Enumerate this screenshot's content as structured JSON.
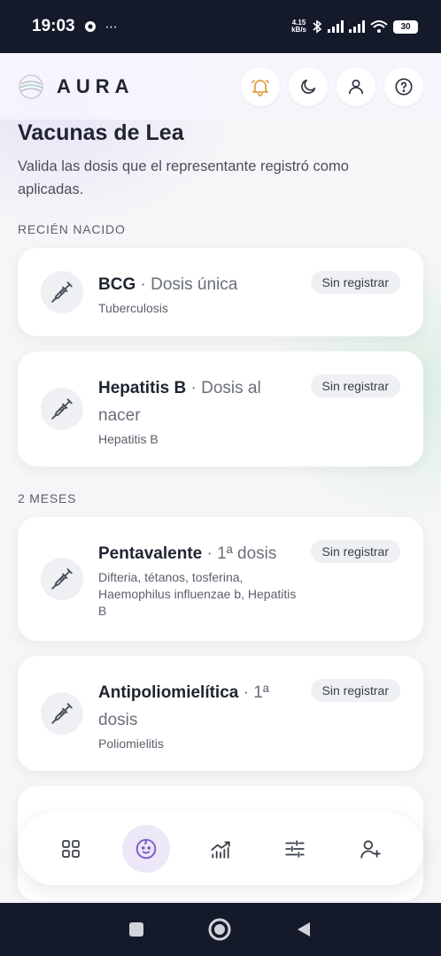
{
  "status_bar": {
    "time": "19:03",
    "extra": "⋯",
    "net_speed_value": "4.15",
    "net_speed_unit": "kB/s",
    "battery": "30"
  },
  "header": {
    "brand": "AURA",
    "icons": [
      "bell-icon",
      "moon-icon",
      "user-icon",
      "help-icon"
    ]
  },
  "page": {
    "title": "Vacunas de Lea",
    "subtitle": "Valida las dosis que el representante registró como aplicadas."
  },
  "sections": [
    {
      "label": "RECIÉN NACIDO",
      "vaccines": [
        {
          "name": "BCG",
          "separator": " · ",
          "dose": "Dosis única",
          "disease": "Tuberculosis",
          "status": "Sin registrar"
        },
        {
          "name": "Hepatitis B",
          "separator": " · ",
          "dose": "Dosis al nacer",
          "disease": "Hepatitis B",
          "status": "Sin registrar"
        }
      ]
    },
    {
      "label": "2 MESES",
      "vaccines": [
        {
          "name": "Pentavalente",
          "separator": " · ",
          "dose": "1ª dosis",
          "disease": "Difteria, tétanos, tosferina, Haemophilus influenzae b, Hepatitis B",
          "status": "Sin registrar"
        },
        {
          "name": "Antipoliomielítica",
          "separator": " · ",
          "dose": "1ª dosis",
          "disease": "Poliomielitis",
          "status": "Sin registrar"
        }
      ]
    }
  ],
  "bottom_nav": {
    "items": [
      "grid-icon",
      "baby-face-icon",
      "chart-icon",
      "sliders-icon",
      "add-user-icon"
    ],
    "active": "baby-face-icon"
  },
  "colors": {
    "status_bar_bg": "#141a2a",
    "accent_purple": "#7b5cc9",
    "badge_bg": "#eef0f3",
    "active_nav_bg": "#ece8f8"
  }
}
